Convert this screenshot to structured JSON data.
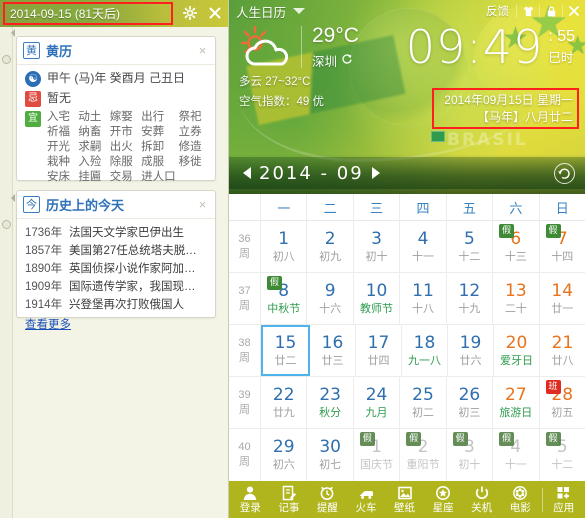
{
  "left_panel": {
    "titlebar": {
      "date_text": "2014-09-15  (81天后)",
      "settings_icon": "gear-icon",
      "close_icon": "close-icon"
    },
    "huangli_card": {
      "badge": "黄",
      "title": "黄历",
      "close": "×",
      "ganzhi_icon": "taiji-icon",
      "ganzhi": "甲午 (马)年  癸酉月  己丑日",
      "ji_icon": "忌",
      "ji_text": "暂无",
      "yi_icon": "宜",
      "yi_items": [
        "入宅",
        "动土",
        "嫁娶",
        "出行",
        "祭祀",
        "祈福",
        "纳畜",
        "开市",
        "安葬",
        "立券",
        "开光",
        "求嗣",
        "出火",
        "拆卸",
        "修造",
        "栽种",
        "入殓",
        "除服",
        "成服",
        "移徙",
        "安床",
        "挂匾",
        "交易",
        "进人口"
      ]
    },
    "history_card": {
      "badge": "今",
      "title": "历史上的今天",
      "close": "×",
      "rows": [
        {
          "year": "1736年",
          "text": "法国天文学家巴伊出生"
        },
        {
          "year": "1857年",
          "text": "美国第27任总统塔夫脱…"
        },
        {
          "year": "1890年",
          "text": "英国侦探小说作家阿加…"
        },
        {
          "year": "1909年",
          "text": "国际遗传学家，我国现…"
        },
        {
          "year": "1914年",
          "text": "兴登堡再次打败俄国人"
        }
      ],
      "more": "查看更多"
    }
  },
  "right_panel": {
    "topbar": {
      "app_title": "人生日历",
      "caret": "chevron-down-icon",
      "feedback": "反馈",
      "skin_icon": "shirt-icon",
      "lock_icon": "lock-icon",
      "close_icon": "close-icon"
    },
    "weather": {
      "icon": "sun-cloud-icon",
      "temp": "29°C",
      "city": "深圳",
      "refresh_icon": "refresh-icon",
      "condition": "多云 27~32°C",
      "air": "空气指数：49 优"
    },
    "clock": {
      "time": "09:49",
      "seconds": ": 55",
      "shichen": "巳时"
    },
    "date_box": {
      "line1": "2014年09月15日  星期一",
      "line2": "【马年】八月廿二"
    },
    "brand": "BRASIL",
    "monthbar": {
      "prev": "prev-month-arrow",
      "label": "2014 - 09",
      "next": "next-month-arrow",
      "today_icon": "back-to-today-icon"
    },
    "calendar": {
      "weekdays": [
        "一",
        "二",
        "三",
        "四",
        "五",
        "六",
        "日"
      ],
      "week_unit": "周",
      "rows": [
        {
          "week": "36",
          "days": [
            {
              "num": "1",
              "sub": "初八",
              "type": "normal"
            },
            {
              "num": "2",
              "sub": "初九",
              "type": "normal"
            },
            {
              "num": "3",
              "sub": "初十",
              "type": "normal"
            },
            {
              "num": "4",
              "sub": "十一",
              "type": "normal"
            },
            {
              "num": "5",
              "sub": "十二",
              "type": "normal"
            },
            {
              "num": "6",
              "sub": "十三",
              "type": "weekend",
              "badge": "假"
            },
            {
              "num": "7",
              "sub": "十四",
              "type": "weekend",
              "badge": "假"
            }
          ]
        },
        {
          "week": "37",
          "days": [
            {
              "num": "8",
              "sub": "中秋节",
              "type": "normal",
              "fest": true,
              "badge": "假"
            },
            {
              "num": "9",
              "sub": "十六",
              "type": "normal"
            },
            {
              "num": "10",
              "sub": "教师节",
              "type": "normal",
              "fest": true
            },
            {
              "num": "11",
              "sub": "十八",
              "type": "normal"
            },
            {
              "num": "12",
              "sub": "十九",
              "type": "normal"
            },
            {
              "num": "13",
              "sub": "二十",
              "type": "weekend"
            },
            {
              "num": "14",
              "sub": "廿一",
              "type": "weekend"
            }
          ]
        },
        {
          "week": "38",
          "days": [
            {
              "num": "15",
              "sub": "廿二",
              "type": "normal",
              "selected": true
            },
            {
              "num": "16",
              "sub": "廿三",
              "type": "normal"
            },
            {
              "num": "17",
              "sub": "廿四",
              "type": "normal"
            },
            {
              "num": "18",
              "sub": "九一八",
              "type": "normal",
              "fest": true
            },
            {
              "num": "19",
              "sub": "廿六",
              "type": "normal"
            },
            {
              "num": "20",
              "sub": "爱牙日",
              "type": "weekend",
              "fest": true
            },
            {
              "num": "21",
              "sub": "廿八",
              "type": "weekend"
            }
          ]
        },
        {
          "week": "39",
          "days": [
            {
              "num": "22",
              "sub": "廿九",
              "type": "normal"
            },
            {
              "num": "23",
              "sub": "秋分",
              "type": "normal",
              "fest": true
            },
            {
              "num": "24",
              "sub": "九月",
              "type": "normal",
              "fest": true
            },
            {
              "num": "25",
              "sub": "初二",
              "type": "normal"
            },
            {
              "num": "26",
              "sub": "初三",
              "type": "normal"
            },
            {
              "num": "27",
              "sub": "旅游日",
              "type": "weekend",
              "fest": true
            },
            {
              "num": "28",
              "sub": "初五",
              "type": "weekend",
              "badge": "班",
              "badge_type": "ban"
            }
          ]
        },
        {
          "week": "40",
          "days": [
            {
              "num": "29",
              "sub": "初六",
              "type": "normal"
            },
            {
              "num": "30",
              "sub": "初七",
              "type": "normal"
            },
            {
              "num": "1",
              "sub": "国庆节",
              "type": "other",
              "badge": "假",
              "badge_type": "dim"
            },
            {
              "num": "2",
              "sub": "重阳节",
              "type": "other",
              "badge": "假",
              "badge_type": "dim"
            },
            {
              "num": "3",
              "sub": "初十",
              "type": "other",
              "badge": "假",
              "badge_type": "dim"
            },
            {
              "num": "4",
              "sub": "十一",
              "type": "other",
              "badge": "假",
              "badge_type": "dim"
            },
            {
              "num": "5",
              "sub": "十二",
              "type": "other",
              "badge": "假",
              "badge_type": "dim"
            }
          ]
        }
      ]
    },
    "toolbar": {
      "items": [
        {
          "label": "登录",
          "icon": "user-icon"
        },
        {
          "label": "记事",
          "icon": "note-icon"
        },
        {
          "label": "提醒",
          "icon": "alarm-icon"
        },
        {
          "label": "火车",
          "icon": "train-icon"
        },
        {
          "label": "壁纸",
          "icon": "wallpaper-icon"
        },
        {
          "label": "星座",
          "icon": "zodiac-icon"
        },
        {
          "label": "关机",
          "icon": "power-icon"
        },
        {
          "label": "电影",
          "icon": "film-icon"
        },
        {
          "label": "应用",
          "icon": "apps-icon"
        }
      ]
    }
  },
  "colors": {
    "accent_green": "#b0b51e",
    "link_blue": "#2f72b8",
    "weekend_orange": "#e8731c",
    "festival_green": "#2f9b4e",
    "highlight_red": "#ff1f1f"
  }
}
